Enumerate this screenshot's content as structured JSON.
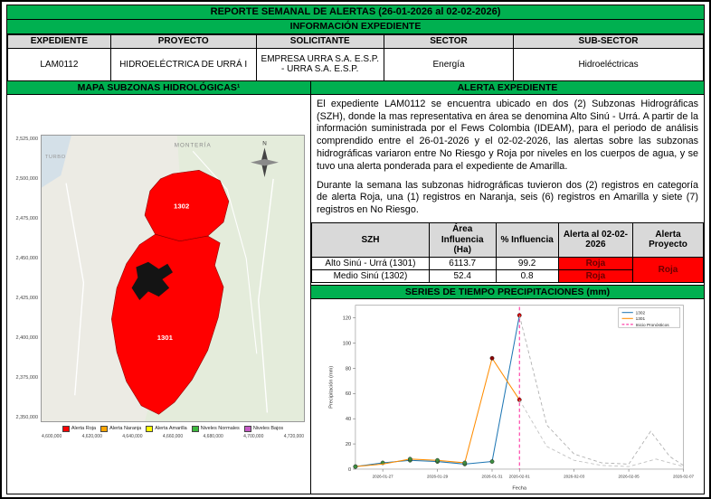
{
  "title": "REPORTE SEMANAL DE ALERTAS (26-01-2026 al 02-02-2026)",
  "info_header": "INFORMACIÓN EXPEDIENTE",
  "info_table": {
    "headers": [
      "EXPEDIENTE",
      "PROYECTO",
      "SOLICITANTE",
      "SECTOR",
      "SUB-SECTOR"
    ],
    "row": [
      "LAM0112",
      "HIDROELÉCTRICA DE URRÁ I",
      "EMPRESA URRA S.A. E.S.P. - URRA S.A. E.S.P.",
      "Energía",
      "Hidroeléctricas"
    ]
  },
  "map_section": {
    "header": "MAPA SUBZONAS HIDROLÓGICAS¹",
    "y_axis": [
      "2,525,000",
      "2,500,000",
      "2,475,000",
      "2,450,000",
      "2,425,000",
      "2,400,000",
      "2,375,000",
      "2,350,000"
    ],
    "x_axis": [
      "4,600,000",
      "4,620,000",
      "4,640,000",
      "4,660,000",
      "4,680,000",
      "4,700,000",
      "4,720,000"
    ],
    "labels": {
      "city_top": "MONTERÍA",
      "city_left": "TURBO",
      "zone_upper": "1302",
      "zone_lower": "1301",
      "compass_n": "N"
    },
    "legend": [
      {
        "label": "Alerta Roja",
        "color": "#FF0000"
      },
      {
        "label": "Alerta Naranja",
        "color": "#FFA500"
      },
      {
        "label": "Alerta Amarilla",
        "color": "#FFFF00"
      },
      {
        "label": "Niveles Normales",
        "color": "#3DB83D"
      },
      {
        "label": "Niveles Bajos",
        "color": "#C55AC5"
      }
    ]
  },
  "alert_section": {
    "header": "ALERTA EXPEDIENTE",
    "paragraph1": "El expediente LAM0112 se encuentra ubicado en dos (2) Subzonas Hidrográficas (SZH), donde la mas representativa en área se denomina Alto Sinú - Urrá. A partir de la información suministrada por el Fews Colombia (IDEAM), para el periodo de análisis comprendido entre el 26-01-2026 y el 02-02-2026, las alertas sobre las subzonas hidrográficas variaron entre No Riesgo y Roja por niveles en los cuerpos de agua, y se tuvo una alerta ponderada para el expediente de Amarilla.",
    "paragraph2": "Durante la semana las subzonas hidrográficas tuvieron dos (2) registros en categoría de alerta Roja, una (1) registros en Naranja, seis (6) registros en Amarilla y siete (7) registros en No Riesgo.",
    "table": {
      "headers": [
        "SZH",
        "Área Influencia (Ha)",
        "% Influencia",
        "Alerta al 02-02-2026",
        "Alerta Proyecto"
      ],
      "rows": [
        {
          "szh": "Alto Sinú - Urrá (1301)",
          "area": "6113.7",
          "pct": "99.2",
          "alerta": "Roja"
        },
        {
          "szh": "Medio Sinú (1302)",
          "area": "52.4",
          "pct": "0.8",
          "alerta": "Roja"
        }
      ],
      "proyecto_alert": "Roja"
    }
  },
  "chart_section": {
    "header": "SERIES DE TIEMPO PRECIPITACIONES (mm)"
  },
  "chart_data": {
    "type": "line",
    "title": "SERIES DE TIEMPO PRECIPITACIONES (mm)",
    "xlabel": "Fecha",
    "ylabel": "Precipitación (mm)",
    "ylim": [
      0,
      130
    ],
    "yticks": [
      0,
      20,
      40,
      60,
      80,
      100,
      120
    ],
    "xmin": 0,
    "xmax": 12,
    "x_dates": [
      "2026-01-26",
      "2026-01-27",
      "2026-01-28",
      "2026-01-29",
      "2026-01-30",
      "2026-01-31",
      "2026-02-01",
      "2026-02-02",
      "2026-02-03",
      "2026-02-04",
      "2026-02-05",
      "2026-02-06",
      "2026-02-07"
    ],
    "xticks": [
      {
        "v": 1,
        "label": "2026-01-27"
      },
      {
        "v": 3,
        "label": "2026-01-29"
      },
      {
        "v": 5,
        "label": "2026-01-31"
      },
      {
        "v": 6,
        "label": "2026-02-01"
      },
      {
        "v": 8,
        "label": "2026-02-03"
      },
      {
        "v": 10,
        "label": "2026-02-05"
      },
      {
        "v": 12,
        "label": "2026-02-07"
      }
    ],
    "forecast_start_x": 6,
    "colors": {
      "s1302": "#1F77B4",
      "s1301": "#FF8C00",
      "forecast": "#B0B0B0",
      "forecast_line": "#FF1493",
      "marker_normal": "#3E8E41",
      "marker_alert": "#D40000"
    },
    "series": [
      {
        "name": "1302",
        "color": "#1F77B4",
        "dashed": false,
        "points": [
          [
            0,
            2
          ],
          [
            1,
            5
          ],
          [
            2,
            7
          ],
          [
            3,
            6
          ],
          [
            4,
            4
          ],
          [
            5,
            6
          ],
          [
            6,
            122
          ]
        ],
        "markers": [
          [
            0,
            2,
            "#3E8E41"
          ],
          [
            1,
            5,
            "#3E8E41"
          ],
          [
            2,
            7,
            "#3E8E41"
          ],
          [
            3,
            6,
            "#3E8E41"
          ],
          [
            4,
            4,
            "#3E8E41"
          ],
          [
            5,
            6,
            "#3E8E41"
          ],
          [
            6,
            122,
            "#D40000"
          ]
        ]
      },
      {
        "name": "1301",
        "color": "#FF8C00",
        "dashed": false,
        "points": [
          [
            0,
            2
          ],
          [
            1,
            4
          ],
          [
            2,
            8
          ],
          [
            3,
            7
          ],
          [
            4,
            5
          ],
          [
            5,
            88
          ],
          [
            6,
            55
          ]
        ],
        "markers": [
          [
            0,
            2,
            "#3E8E41"
          ],
          [
            2,
            8,
            "#3E8E41"
          ],
          [
            3,
            7,
            "#3E8E41"
          ],
          [
            4,
            5,
            "#3E8E41"
          ],
          [
            5,
            88,
            "#8B0000"
          ],
          [
            6,
            55,
            "#D40000"
          ]
        ]
      },
      {
        "name": "forecast-1302",
        "color": "#ADADAD",
        "dashed": true,
        "points": [
          [
            6,
            122
          ],
          [
            7,
            35
          ],
          [
            8,
            12
          ],
          [
            9,
            5
          ],
          [
            10,
            4
          ],
          [
            10.8,
            30
          ],
          [
            11.5,
            10
          ],
          [
            12,
            3
          ]
        ]
      },
      {
        "name": "forecast-1301",
        "color": "#C0C0C0",
        "dashed": true,
        "points": [
          [
            6,
            55
          ],
          [
            7,
            18
          ],
          [
            8,
            7
          ],
          [
            9,
            3
          ],
          [
            10,
            2
          ],
          [
            11,
            8
          ],
          [
            12,
            2
          ]
        ]
      }
    ],
    "legend": [
      {
        "label": "1302",
        "color": "#1F77B4",
        "dashed": false
      },
      {
        "label": "1301",
        "color": "#FF8C00",
        "dashed": false
      },
      {
        "label": "Inicio Pronósticos",
        "color": "#FF1493",
        "dashed": true
      }
    ],
    "legend_position": "top-right",
    "grid": false
  }
}
